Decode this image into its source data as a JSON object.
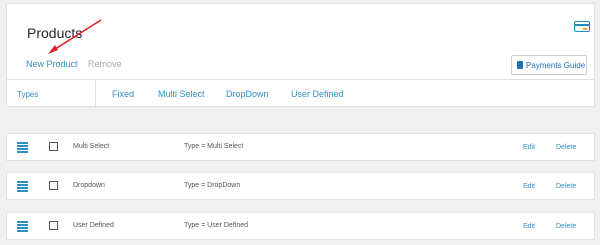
{
  "header": {
    "title": "Products",
    "icon": "credit-card-icon",
    "actions": {
      "new_product": "New Product",
      "remove": "Remove"
    },
    "payments_guide": "Payments Guide"
  },
  "tabs": {
    "types": "Types",
    "items": [
      "Fixed",
      "Multi Select",
      "DropDown",
      "User Defined"
    ]
  },
  "rows": [
    {
      "name": "Multi Select",
      "type": "Type = Multi Select",
      "edit": "Edit",
      "delete": "Delete"
    },
    {
      "name": "Dropdown",
      "type": "Type = DropDown",
      "edit": "Edit",
      "delete": "Delete"
    },
    {
      "name": "User Defined",
      "type": "Type = User Defined",
      "edit": "Edit",
      "delete": "Delete"
    }
  ],
  "colors": {
    "accent": "#2f8fc4",
    "annotation_arrow": "#e02020"
  }
}
